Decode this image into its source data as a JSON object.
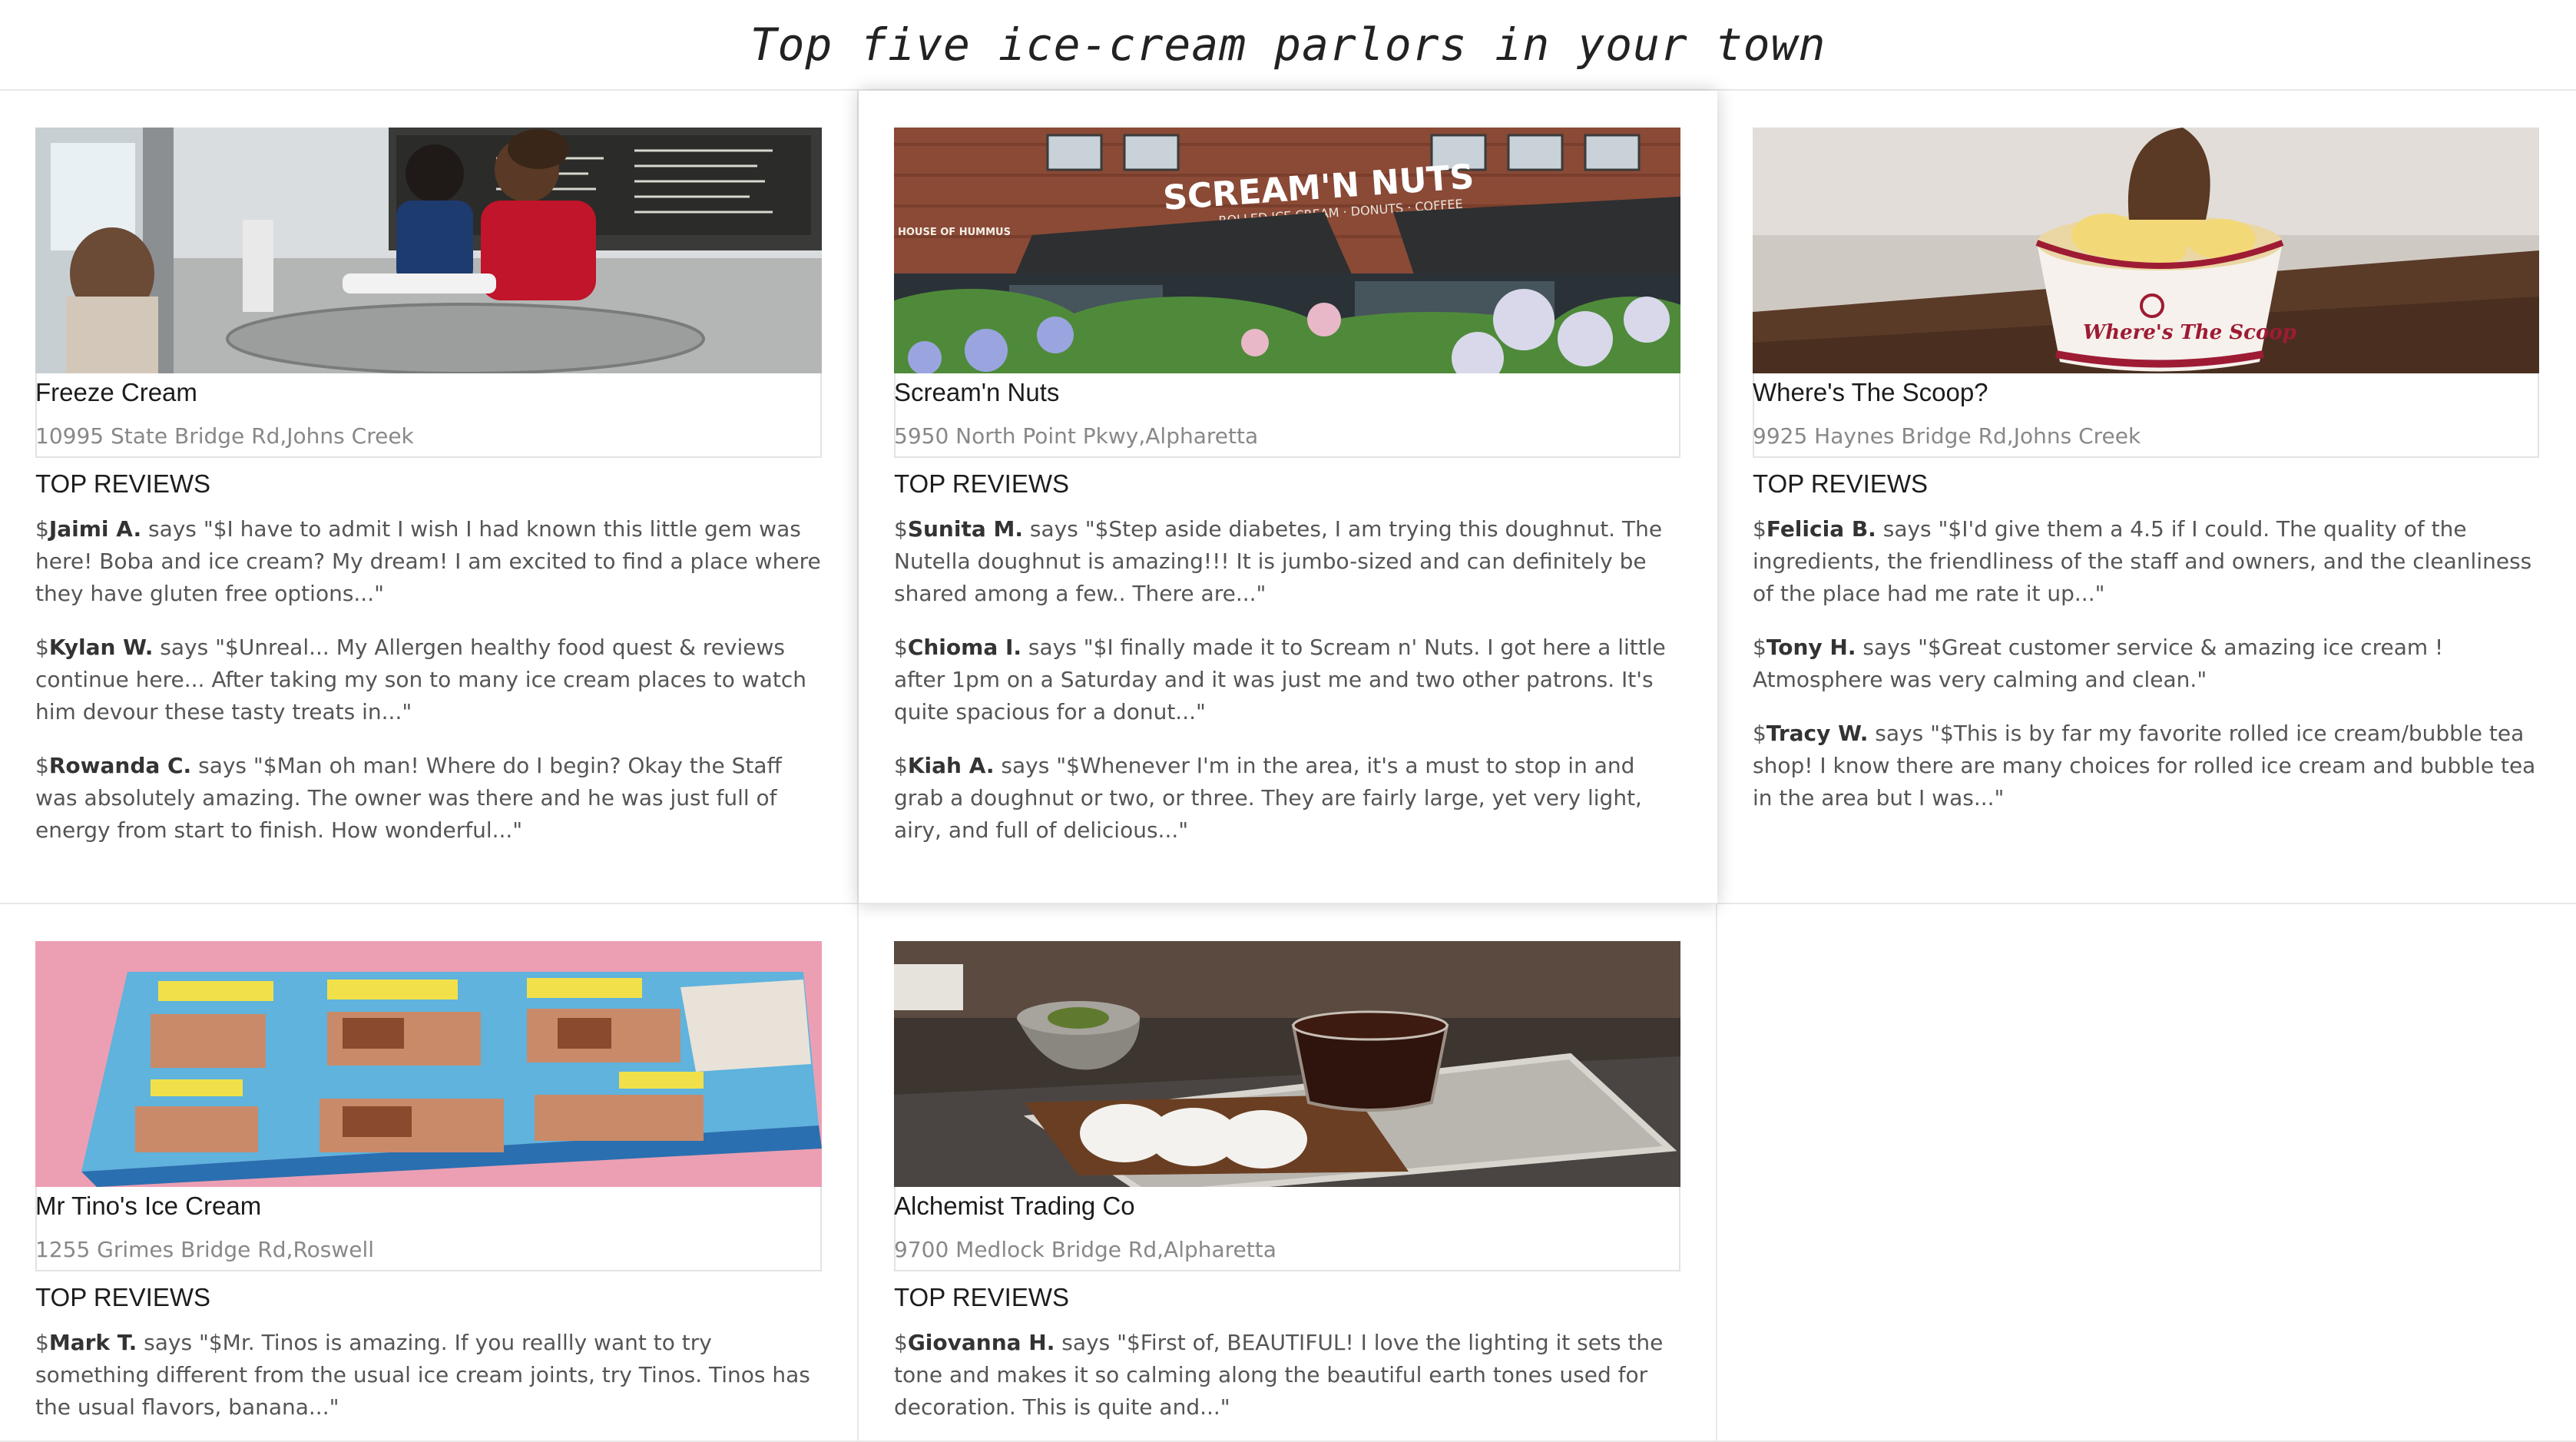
{
  "page": {
    "title": "Top five ice-cream parlors in your town"
  },
  "labels": {
    "top_reviews": "TOP REVIEWS",
    "says": " says "
  },
  "parlors": [
    {
      "name": "Freeze Cream",
      "address": "10995 State Bridge Rd,Johns Creek",
      "reviews": [
        {
          "prefix": "$",
          "author": "Jaimi A.",
          "text": "\"$I have to admit I wish I had known this little gem was here! Boba and ice cream? My dream! I am excited to find a place where they have gluten free options...\""
        },
        {
          "prefix": "$",
          "author": "Kylan W.",
          "text": "\"$Unreal... My Allergen healthy food quest & reviews continue here... After taking my son to many ice cream places to watch him devour these tasty treats in...\""
        },
        {
          "prefix": "$",
          "author": "Rowanda C.",
          "text": "\"$Man oh man! Where do I begin? Okay the Staff was absolutely amazing. The owner was there and he was just full of energy from start to finish. How wonderful...\""
        }
      ]
    },
    {
      "name": "Scream'n Nuts",
      "address": "5950 North Point Pkwy,Alpharetta",
      "reviews": [
        {
          "prefix": "$",
          "author": "Sunita M.",
          "text": "\"$Step aside diabetes, I am trying this doughnut. The Nutella doughnut is amazing!!! It is jumbo-sized and can definitely be shared among a few.. There are...\""
        },
        {
          "prefix": "$",
          "author": "Chioma I.",
          "text": "\"$I finally made it to Scream n' Nuts. I got here a little after 1pm on a Saturday and it was just me and two other patrons. It's quite spacious for a donut...\""
        },
        {
          "prefix": "$",
          "author": "Kiah A.",
          "text": "\"$Whenever I'm in the area, it's a must to stop in and grab a doughnut or two, or three. They are fairly large, yet very light, airy, and full of delicious...\""
        }
      ]
    },
    {
      "name": "Where's The Scoop?",
      "address": "9925 Haynes Bridge Rd,Johns Creek",
      "reviews": [
        {
          "prefix": "$",
          "author": "Felicia B.",
          "text": "\"$I'd give them a 4.5 if I could. The quality of the ingredients, the friendliness of the staff and owners, and the cleanliness of the place had me rate it up...\""
        },
        {
          "prefix": "$",
          "author": "Tony H.",
          "text": "\"$Great customer service & amazing ice cream ! Atmosphere was very calming and clean.\""
        },
        {
          "prefix": "$",
          "author": "Tracy W.",
          "text": "\"$This is by far my favorite rolled ice cream/bubble tea shop! I know there are many choices for rolled ice cream and bubble tea in the area but I was...\""
        }
      ]
    },
    {
      "name": "Mr Tino's Ice Cream",
      "address": "1255 Grimes Bridge Rd,Roswell",
      "reviews": [
        {
          "prefix": "$",
          "author": "Mark T.",
          "text": "\"$Mr. Tinos is amazing. If you reallly want to try something different from the usual ice cream joints, try Tinos. Tinos has the usual flavors, banana...\""
        }
      ]
    },
    {
      "name": "Alchemist Trading Co",
      "address": "9700 Medlock Bridge Rd,Alpharetta",
      "reviews": [
        {
          "prefix": "$",
          "author": "Giovanna H.",
          "text": "\"$First of, BEAUTIFUL! I love the lighting it sets the tone and makes it so calming along the beautiful earth tones used for decoration. This is quite and...\""
        }
      ]
    }
  ],
  "photo_signs": {
    "storefront_sign": "SCREAM'N NUTS",
    "storefront_subsign": "ROLLED ICE CREAM · DONUTS · COFFEE",
    "neighbor_sign": "HOUSE OF HUMMUS",
    "cup_logo": "Where's The Scoop"
  }
}
